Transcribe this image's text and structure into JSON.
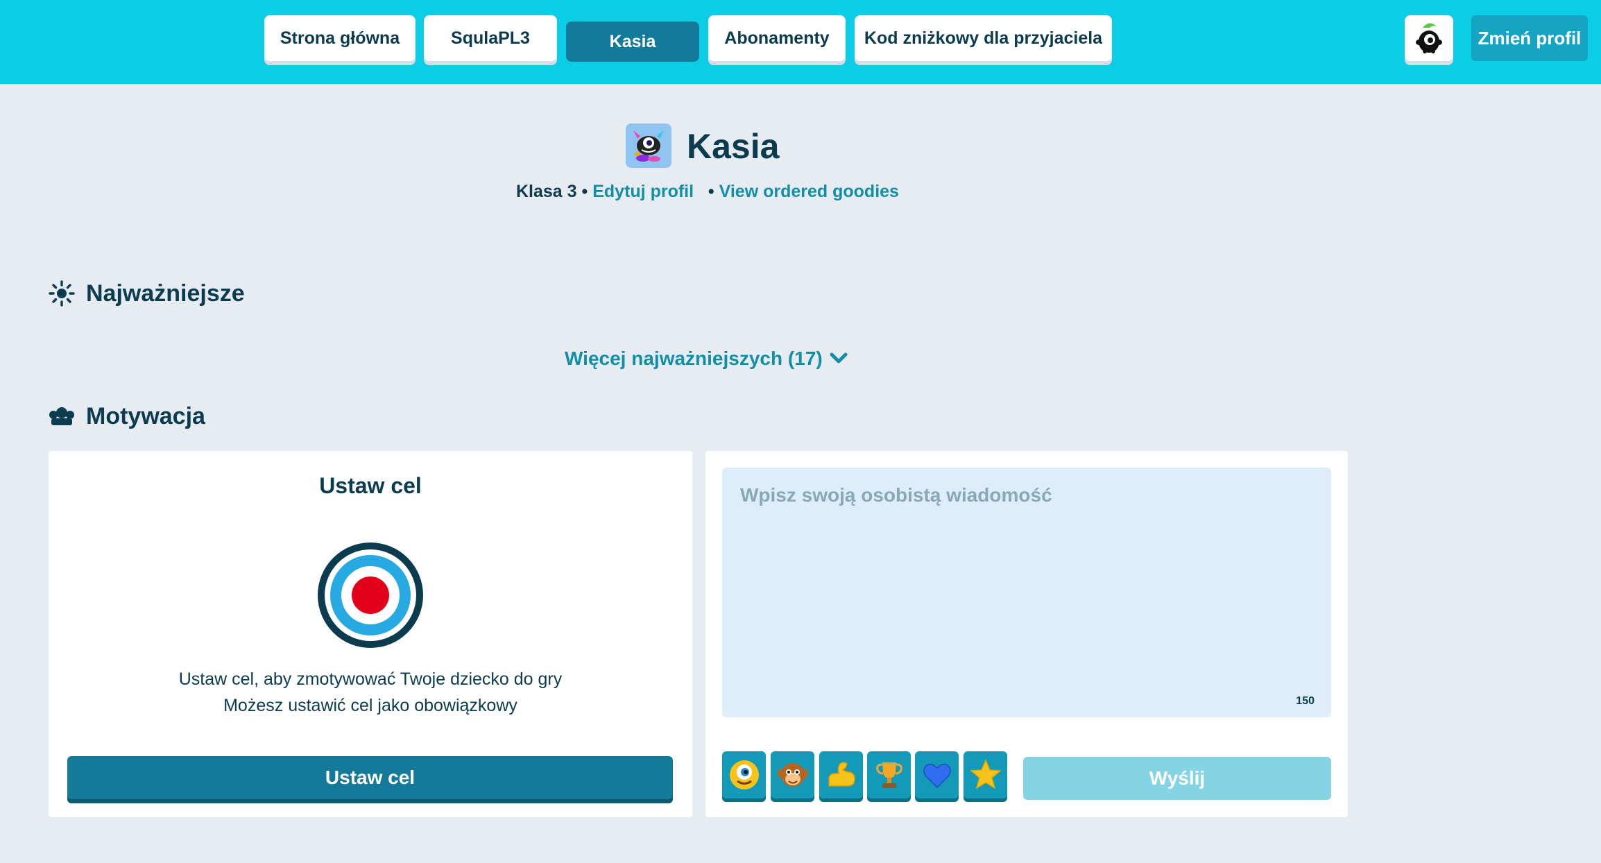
{
  "nav": {
    "tabs": [
      {
        "label": "Strona główna"
      },
      {
        "label": "SqulaPL3"
      },
      {
        "label": "Kasia",
        "active": true
      },
      {
        "label": "Abonamenty"
      },
      {
        "label": "Kod zniżkowy dla przyjaciela"
      }
    ],
    "mascot_icon": "squla-mascot-icon",
    "change_profile_label": "Zmień profil"
  },
  "profile": {
    "name": "Kasia",
    "avatar_icon": "monster-avatar-icon",
    "class_label": "Klasa 3",
    "separator": "•",
    "edit_link": "Edytuj profil",
    "goodies_link": "View ordered goodies"
  },
  "highlights": {
    "title": "Najważniejsze",
    "icon": "sun-icon",
    "more_label": "Więcej najważniejszych (17)"
  },
  "motivation": {
    "title": "Motywacja",
    "icon": "crown-icon",
    "goal": {
      "title": "Ustaw cel",
      "line1": "Ustaw cel, aby zmotywować Twoje dziecko do gry",
      "line2": "Możesz ustawić cel jako obowiązkowy",
      "button_label": "Ustaw cel"
    },
    "message": {
      "placeholder": "Wpisz swoją osobistą wiadomość",
      "char_count": "150",
      "send_label": "Wyślij",
      "emojis": [
        "cyclops-emoji",
        "monkey-emoji",
        "flexed-arm-emoji",
        "trophy-emoji",
        "blue-heart-emoji",
        "star-emoji"
      ]
    }
  },
  "colors": {
    "topbar": "#0ccde6",
    "accent_dark": "#137a99",
    "link": "#128fa6",
    "background": "#e6ecf1"
  }
}
